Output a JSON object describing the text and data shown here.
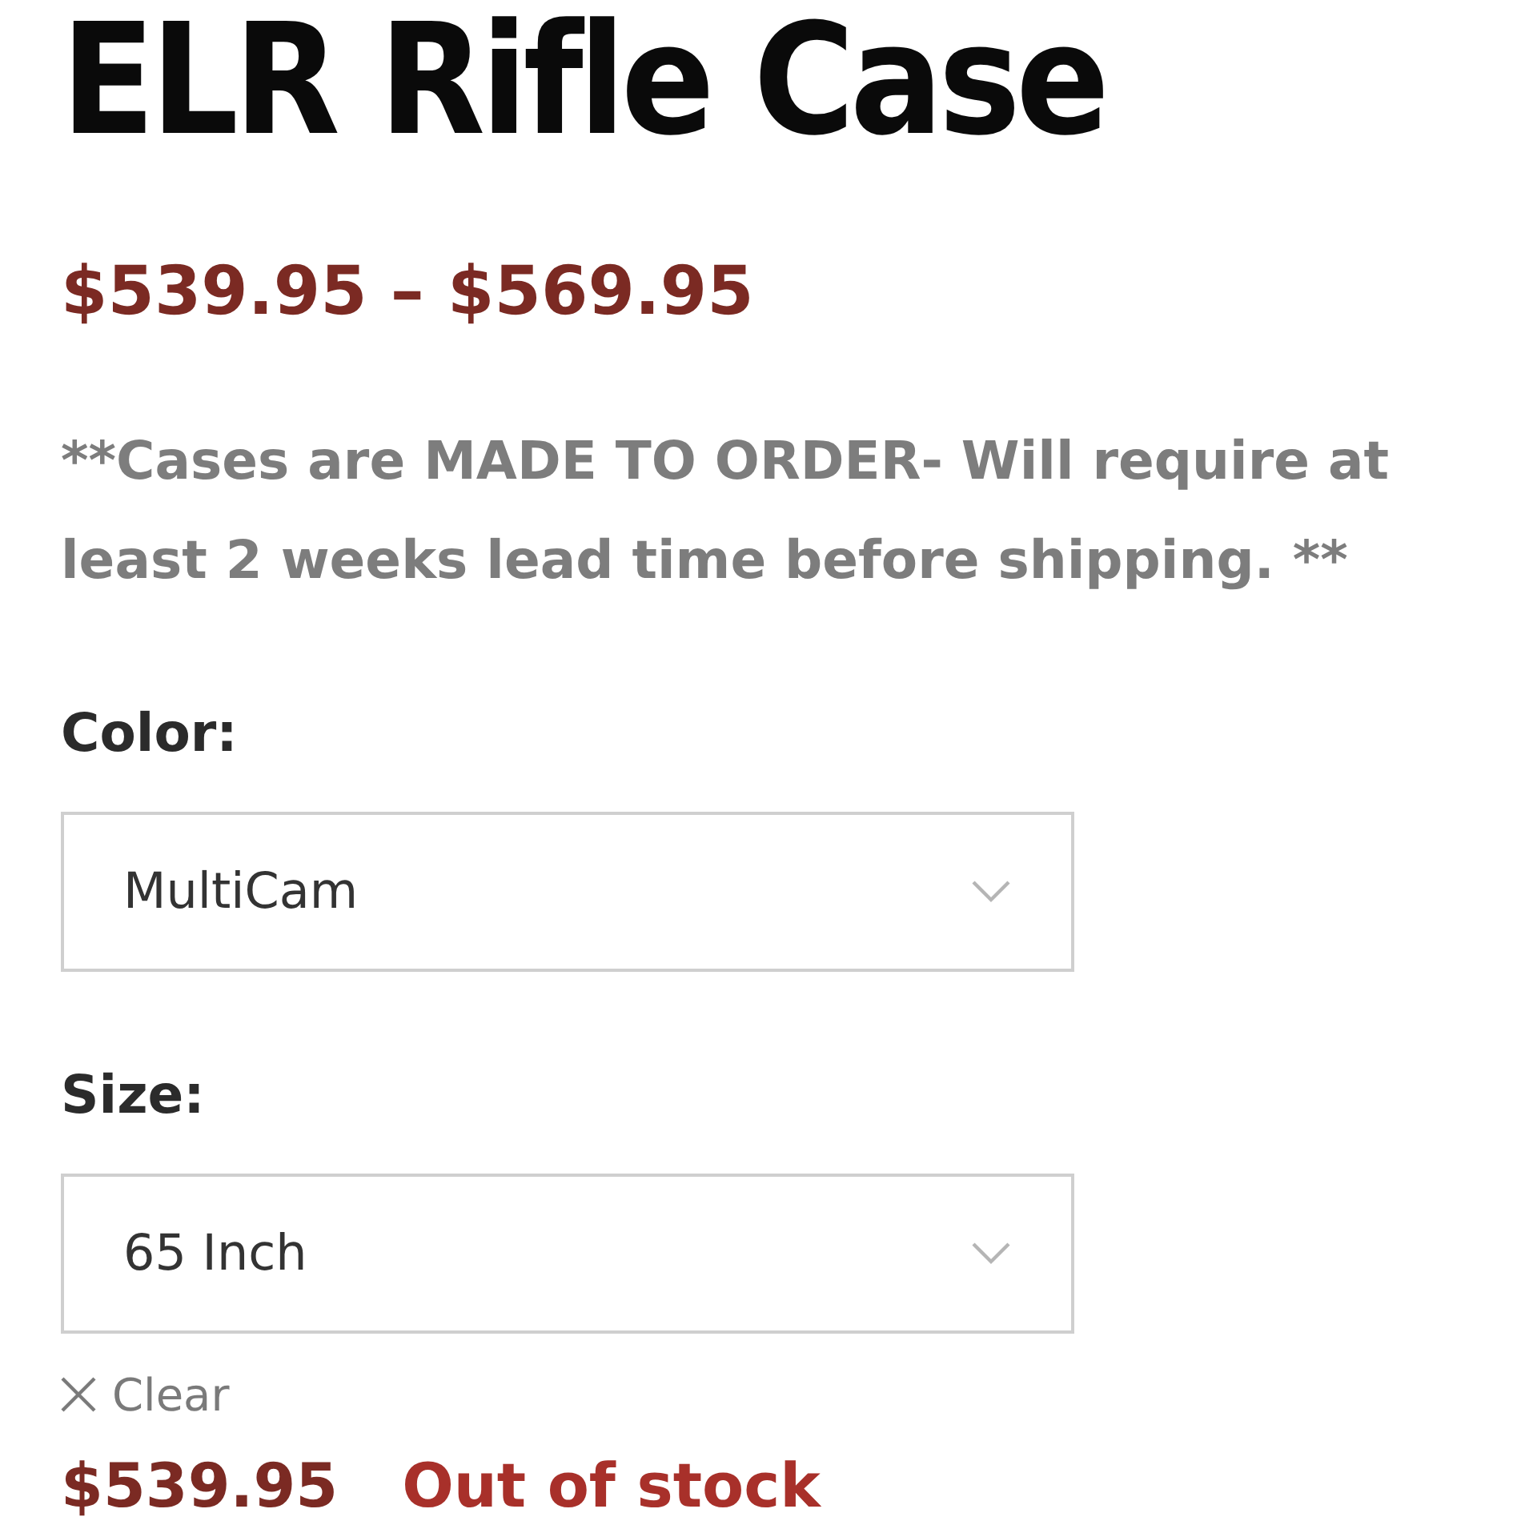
{
  "product": {
    "title": "ELR Rifle Case",
    "price_range": "$539.95 – $569.95",
    "note": "**Cases are MADE TO ORDER- Will require at least 2 weeks lead time before shipping. **"
  },
  "options": [
    {
      "label": "Color:",
      "value": "MultiCam"
    },
    {
      "label": "Size:",
      "value": "65 Inch"
    }
  ],
  "clear_link": "Clear",
  "variant": {
    "price": "$539.95",
    "stock_status": "Out of stock"
  }
}
